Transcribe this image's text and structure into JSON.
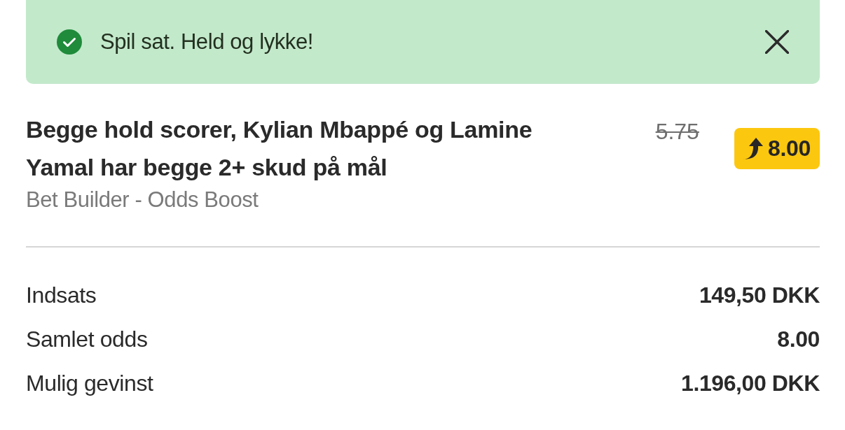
{
  "notification": {
    "kind": "success",
    "message": "Spil sat. Held og lykke!"
  },
  "bet": {
    "title": "Begge hold scorer, Kylian Mbappé og Lamine Yamal har begge 2+ skud på mål",
    "market": "Bet Builder - Odds Boost",
    "old_odds": "5.75",
    "boosted_odds": "8.00"
  },
  "summary": [
    {
      "label": "Indsats",
      "value": "149,50 DKK"
    },
    {
      "label": "Samlet odds",
      "value": "8.00"
    },
    {
      "label": "Mulig gevinst",
      "value": "1.196,00 DKK"
    }
  ]
}
